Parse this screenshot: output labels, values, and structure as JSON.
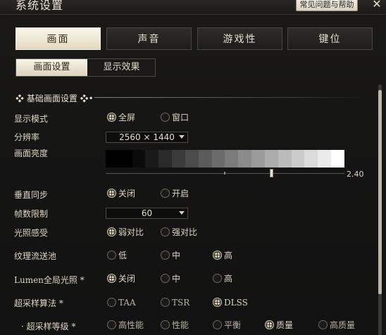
{
  "window": {
    "title": "系统设置",
    "help_label": "常见问题与帮助",
    "close_label": "✕"
  },
  "main_tabs": [
    {
      "label": "画面",
      "active": true
    },
    {
      "label": "声音",
      "active": false
    },
    {
      "label": "游戏性",
      "active": false
    },
    {
      "label": "键位",
      "active": false
    }
  ],
  "sub_tabs": [
    {
      "label": "画面设置",
      "active": true
    },
    {
      "label": "显示效果",
      "active": false
    }
  ],
  "section": {
    "title": "基础画面设置"
  },
  "settings": {
    "display_mode": {
      "label": "显示模式",
      "options": [
        "全屏",
        "窗口"
      ],
      "selected": "全屏"
    },
    "resolution": {
      "label": "分辨率",
      "value": "2560 × 1440"
    },
    "brightness": {
      "label": "画面亮度",
      "value": "2.40"
    },
    "vsync": {
      "label": "垂直同步",
      "options": [
        "关闭",
        "开启"
      ],
      "selected": "关闭"
    },
    "frame_limit": {
      "label": "帧数限制",
      "value": "60"
    },
    "light_sense": {
      "label": "光照感受",
      "options": [
        "弱对比",
        "强对比"
      ],
      "selected": "弱对比"
    },
    "texture_pool": {
      "label": "纹理流送池",
      "options": [
        "低",
        "中",
        "高"
      ],
      "selected": "高"
    },
    "lumen_gi": {
      "label": "Lumen全局光照 *",
      "options": [
        "关闭",
        "中",
        "高"
      ],
      "selected": "关闭"
    },
    "upscaling": {
      "label": "超采样算法 *",
      "options": [
        "TAA",
        "TSR",
        "DLSS"
      ],
      "selected": "DLSS"
    },
    "upscale_level": {
      "label": "· 超采样等级 *",
      "options": [
        "高性能",
        "性能",
        "平衡",
        "质量",
        "高质量"
      ],
      "selected": "质量"
    }
  },
  "colors": {
    "accent": "#e2d9c2",
    "background": "#151514",
    "text": "#d9d3c4"
  },
  "brightness_steps": [
    "#000000",
    "#000000",
    "#0b0b0b",
    "#1a1a1a",
    "#2a2a2a",
    "#3b3b3b",
    "#4b4b4b",
    "#5b5b5b",
    "#6b6b6b",
    "#7b7b7b",
    "#8b8b8b",
    "#9b9b9b",
    "#ababab",
    "#bbbbbb",
    "#cbcbcb",
    "#dbdbdb",
    "#ebebeb",
    "#ffffff"
  ]
}
